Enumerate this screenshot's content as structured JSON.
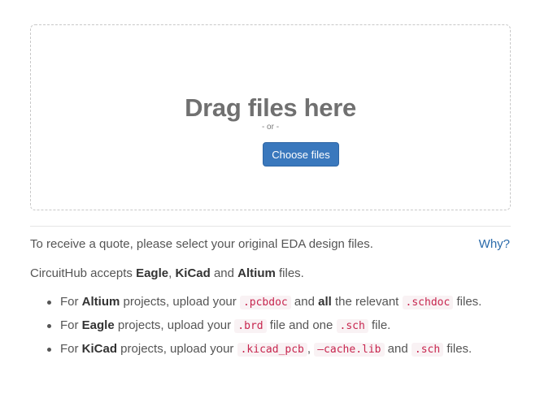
{
  "dropzone": {
    "title": "Drag files here",
    "or_text": "- or -",
    "button_label": "Choose files",
    "button_color": "#3a78bd"
  },
  "info": {
    "quote_text": "To receive a quote, please select your original EDA design files.",
    "why_link": "Why?",
    "accepts_prefix": "CircuitHub accepts ",
    "formats": [
      "Eagle",
      "KiCad",
      "Altium"
    ],
    "accepts_sep1": ", ",
    "accepts_sep2": " and ",
    "accepts_suffix": " files."
  },
  "instructions": [
    {
      "prefix": "For ",
      "tool": "Altium",
      "mid1": " projects, upload your ",
      "ext1": ".pcbdoc",
      "mid2": " and ",
      "bold2": "all",
      "mid3": " the relevant ",
      "ext2": ".schdoc",
      "suffix": " files."
    },
    {
      "prefix": "For ",
      "tool": "Eagle",
      "mid1": " projects, upload your ",
      "ext1": ".brd",
      "mid2": " file and one ",
      "ext2": ".sch",
      "suffix": " file."
    },
    {
      "prefix": "For ",
      "tool": "KiCad",
      "mid1": " projects, upload your ",
      "ext1": ".kicad_pcb",
      "sep1": ", ",
      "ext2": "–cache.lib",
      "mid2": " and ",
      "ext3": ".sch",
      "suffix": " files."
    }
  ]
}
